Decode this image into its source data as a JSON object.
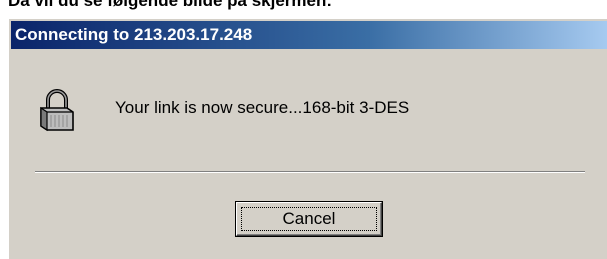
{
  "caption": "Da vil du se følgende bilde på skjermen:",
  "dialog": {
    "title": "Connecting to 213.203.17.248",
    "message": "Your link is now secure...168-bit 3-DES",
    "icon": "padlock-icon",
    "cancel_label": "Cancel"
  },
  "colors": {
    "dialog_background": "#d4d0c8",
    "titlebar_start": "#0a246a",
    "titlebar_end": "#a6caf0",
    "titlebar_text": "#ffffff"
  }
}
